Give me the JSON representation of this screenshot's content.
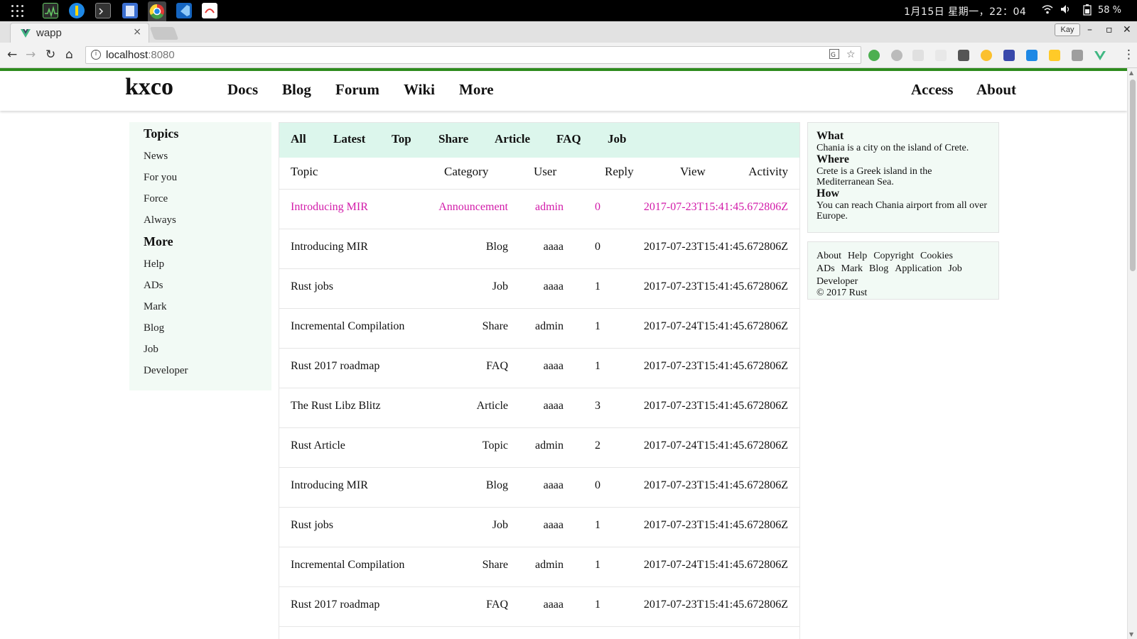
{
  "taskbar": {
    "clock": "1月15日 星期一，22：04",
    "battery": "58 %"
  },
  "browser": {
    "tab_title": "wapp",
    "tab_close": "×",
    "profile_chip": "Kay",
    "url_host": "localhost",
    "url_port": ":8080",
    "win_min": "–",
    "win_max": "▫",
    "win_close": "✕"
  },
  "site": {
    "logo": "kxco",
    "nav": [
      "Docs",
      "Blog",
      "Forum",
      "Wiki",
      "More"
    ],
    "nav_right": [
      "Access",
      "About"
    ]
  },
  "leftnav": {
    "topics_heading": "Topics",
    "topics": [
      "News",
      "For you",
      "Force",
      "Always"
    ],
    "more_heading": "More",
    "more": [
      "Help",
      "ADs",
      "Mark",
      "Blog",
      "Job",
      "Developer"
    ]
  },
  "filters": [
    "All",
    "Latest",
    "Top",
    "Share",
    "Article",
    "FAQ",
    "Job"
  ],
  "columns": {
    "topic": "Topic",
    "category": "Category",
    "user": "User",
    "reply": "Reply",
    "view": "View",
    "activity": "Activity"
  },
  "rows": [
    {
      "topic": "Introducing MIR",
      "category": "Announcement",
      "user": "admin",
      "reply": "0",
      "activity": "2017-07-23T15:41:45.672806Z"
    },
    {
      "topic": "Introducing MIR",
      "category": "Blog",
      "user": "aaaa",
      "reply": "0",
      "activity": "2017-07-23T15:41:45.672806Z"
    },
    {
      "topic": "Rust jobs",
      "category": "Job",
      "user": "aaaa",
      "reply": "1",
      "activity": "2017-07-23T15:41:45.672806Z"
    },
    {
      "topic": "Incremental Compilation",
      "category": "Share",
      "user": "admin",
      "reply": "1",
      "activity": "2017-07-24T15:41:45.672806Z"
    },
    {
      "topic": "Rust 2017 roadmap",
      "category": "FAQ",
      "user": "aaaa",
      "reply": "1",
      "activity": "2017-07-23T15:41:45.672806Z"
    },
    {
      "topic": "The Rust Libz Blitz",
      "category": "Article",
      "user": "aaaa",
      "reply": "3",
      "activity": "2017-07-23T15:41:45.672806Z"
    },
    {
      "topic": "Rust Article",
      "category": "Topic",
      "user": "admin",
      "reply": "2",
      "activity": "2017-07-24T15:41:45.672806Z"
    },
    {
      "topic": "Introducing MIR",
      "category": "Blog",
      "user": "aaaa",
      "reply": "0",
      "activity": "2017-07-23T15:41:45.672806Z"
    },
    {
      "topic": "Rust jobs",
      "category": "Job",
      "user": "aaaa",
      "reply": "1",
      "activity": "2017-07-23T15:41:45.672806Z"
    },
    {
      "topic": "Incremental Compilation",
      "category": "Share",
      "user": "admin",
      "reply": "1",
      "activity": "2017-07-24T15:41:45.672806Z"
    },
    {
      "topic": "Rust 2017 roadmap",
      "category": "FAQ",
      "user": "aaaa",
      "reply": "1",
      "activity": "2017-07-23T15:41:45.672806Z"
    }
  ],
  "info_card": {
    "what_title": "What",
    "what_text": "Chania is a city on the island of Crete.",
    "where_title": "Where",
    "where_text": "Crete is a Greek island in the Mediterranean Sea.",
    "how_title": "How",
    "how_text": "You can reach Chania airport from all over Europe."
  },
  "footer_links": [
    "About",
    "Help",
    "Copyright",
    "Cookies",
    "ADs",
    "Mark",
    "Blog",
    "Application",
    "Job",
    "Developer"
  ],
  "copyright": "© 2017 Rust",
  "colors": {
    "accent_green": "#2e8b1e",
    "highlight_row": "#d21ba9",
    "filter_bg": "#dcf6ec",
    "panel_bg": "#f2faf5"
  },
  "icons": [
    "apps-grid-icon",
    "system-monitor-icon",
    "terminal-icon",
    "chrome-icon",
    "vscode-icon",
    "vue-favicon-icon",
    "back-icon",
    "forward-icon",
    "reload-icon",
    "home-icon",
    "info-icon",
    "translate-icon",
    "star-icon"
  ]
}
